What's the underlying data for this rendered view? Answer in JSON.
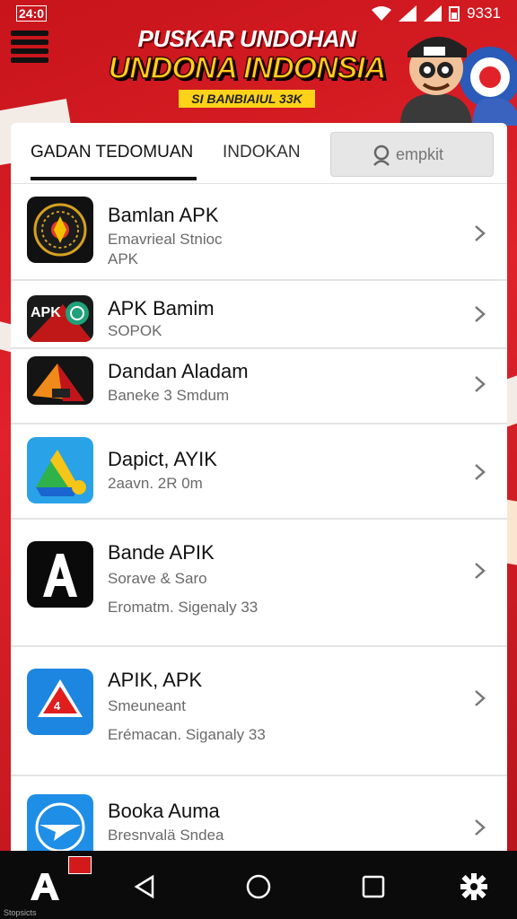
{
  "status_bar": {
    "left_time": "24:0",
    "right_time": "9331"
  },
  "banner": {
    "line1": "PUSKAR UNDOHAN",
    "line2": "UNDONA INDONSIA",
    "line3": "SI BANBIAIUL 33K"
  },
  "tabs": [
    {
      "label": "GADAN TEDOMUAN",
      "active": true
    },
    {
      "label": "INDOKAN",
      "active": false
    }
  ],
  "search": {
    "placeholder": "empkit"
  },
  "apps": [
    {
      "name": "Bamlan APK",
      "line1": "Emavrieal Stnioc",
      "line2": "APK",
      "icon": "compass-icon"
    },
    {
      "name": "APK Bamim",
      "line1": "SOPOK",
      "line2": "",
      "icon": "apk-logo-icon"
    },
    {
      "name": "Dandan Aladam",
      "line1": "Baneke 3 Smdum",
      "line2": "",
      "icon": "pyramid-icon"
    },
    {
      "name": "Dapict, AYIK",
      "line1": "2aavn. 2R 0m",
      "line2": "",
      "icon": "drive-triangle-icon"
    },
    {
      "name": "Bande APIK",
      "line1": "Sorave & Saro",
      "line2": "Eromatm. Sigenaly 33",
      "icon": "letter-a-icon"
    },
    {
      "name": "APIK, APK",
      "line1": "Smeuneant",
      "line2": "Erémacan. Siganaly 33",
      "icon": "warning-triangle-icon"
    },
    {
      "name": "Booka Auma",
      "line1": "Bresnvalä Sndea",
      "line2": "",
      "icon": "plane-icon"
    }
  ],
  "navbar": {
    "tiny_label": "Stopsicts"
  },
  "colors": {
    "brand_red": "#d81e25",
    "accent_yellow": "#ffd21a",
    "card_bg": "#ffffff"
  }
}
